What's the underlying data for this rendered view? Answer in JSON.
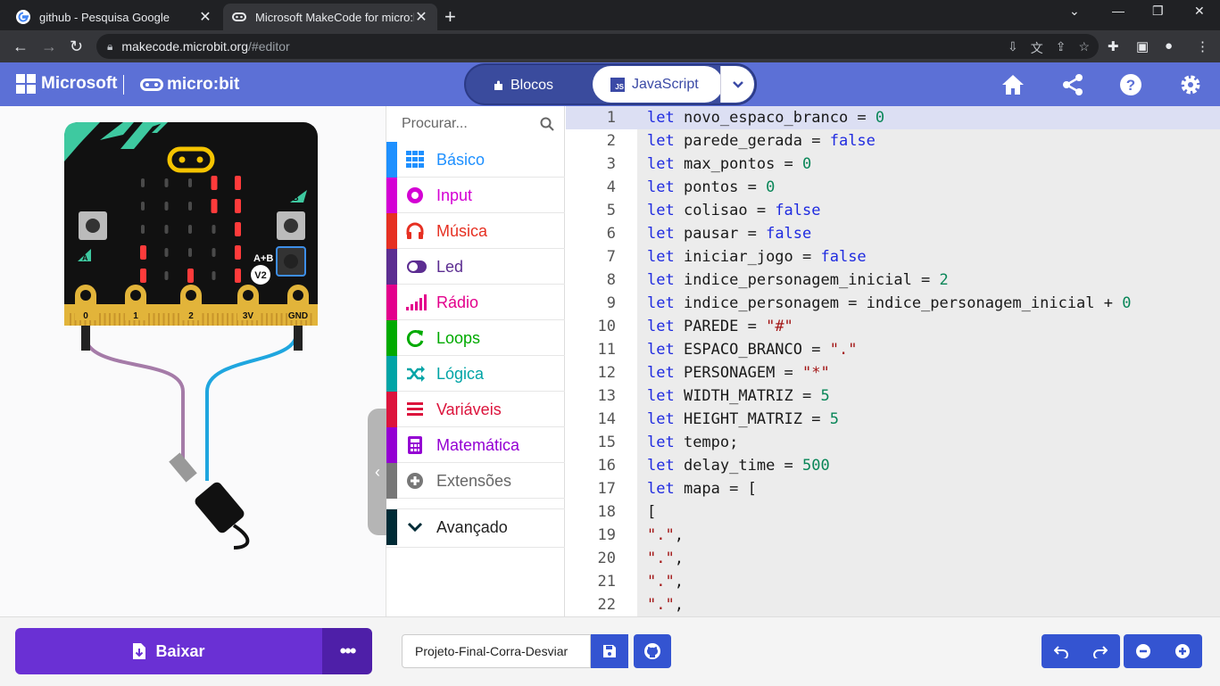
{
  "browser": {
    "tabs": [
      {
        "title": "github - Pesquisa Google",
        "icon": "google-icon"
      },
      {
        "title": "Microsoft MakeCode for micro:bi",
        "icon": "makecode-icon"
      }
    ],
    "url_host": "makecode.microbit.org",
    "url_path": "/#editor"
  },
  "header": {
    "brand": "Microsoft",
    "product": "micro:bit",
    "mode_blocks": "Blocos",
    "mode_js": "JavaScript",
    "js_badge": "JS"
  },
  "simulator": {
    "pins": [
      "0",
      "1",
      "2",
      "3V",
      "GND"
    ],
    "button_a": "A",
    "button_b": "B",
    "button_ab": "A+B",
    "version": "V2",
    "led_on": [
      [
        0,
        0,
        0,
        1,
        1
      ],
      [
        0,
        0,
        0,
        1,
        1
      ],
      [
        0,
        0,
        0,
        0,
        1
      ],
      [
        1,
        0,
        0,
        0,
        1
      ],
      [
        1,
        0,
        1,
        0,
        1
      ]
    ]
  },
  "toolbox": {
    "search_placeholder": "Procurar...",
    "categories": [
      {
        "label": "Básico",
        "color": "#1e90ff",
        "icon": "grid-icon"
      },
      {
        "label": "Input",
        "color": "#d400d4",
        "icon": "target-icon"
      },
      {
        "label": "Música",
        "color": "#e63022",
        "icon": "headphones-icon"
      },
      {
        "label": "Led",
        "color": "#5c2d91",
        "icon": "toggle-icon"
      },
      {
        "label": "Rádio",
        "color": "#e3008c",
        "icon": "signal-icon"
      },
      {
        "label": "Loops",
        "color": "#00aa00",
        "icon": "refresh-icon"
      },
      {
        "label": "Lógica",
        "color": "#00a4a6",
        "icon": "shuffle-icon"
      },
      {
        "label": "Variáveis",
        "color": "#dc143c",
        "icon": "list-icon"
      },
      {
        "label": "Matemática",
        "color": "#9400d3",
        "icon": "calculator-icon"
      },
      {
        "label": "Extensões",
        "color": "#777777",
        "icon": "plus-circle-icon"
      },
      {
        "label": "Avançado",
        "color": "#002b36",
        "icon": "chevron-down-icon"
      }
    ]
  },
  "code_lines": [
    [
      [
        "kw",
        "let"
      ],
      [
        "t",
        " novo_espaco_branco = "
      ],
      [
        "num",
        "0"
      ]
    ],
    [
      [
        "kw",
        "let"
      ],
      [
        "t",
        " parede_gerada = "
      ],
      [
        "kw",
        "false"
      ]
    ],
    [
      [
        "kw",
        "let"
      ],
      [
        "t",
        " max_pontos = "
      ],
      [
        "num",
        "0"
      ]
    ],
    [
      [
        "kw",
        "let"
      ],
      [
        "t",
        " pontos = "
      ],
      [
        "num",
        "0"
      ]
    ],
    [
      [
        "kw",
        "let"
      ],
      [
        "t",
        " colisao = "
      ],
      [
        "kw",
        "false"
      ]
    ],
    [
      [
        "kw",
        "let"
      ],
      [
        "t",
        " pausar = "
      ],
      [
        "kw",
        "false"
      ]
    ],
    [
      [
        "kw",
        "let"
      ],
      [
        "t",
        " iniciar_jogo = "
      ],
      [
        "kw",
        "false"
      ]
    ],
    [
      [
        "kw",
        "let"
      ],
      [
        "t",
        " indice_personagem_inicial = "
      ],
      [
        "num",
        "2"
      ]
    ],
    [
      [
        "kw",
        "let"
      ],
      [
        "t",
        " indice_personagem = indice_personagem_inicial + "
      ],
      [
        "num",
        "0"
      ]
    ],
    [
      [
        "kw",
        "let"
      ],
      [
        "t",
        " PAREDE = "
      ],
      [
        "str",
        "\"#\""
      ]
    ],
    [
      [
        "kw",
        "let"
      ],
      [
        "t",
        " ESPACO_BRANCO = "
      ],
      [
        "str",
        "\".\""
      ]
    ],
    [
      [
        "kw",
        "let"
      ],
      [
        "t",
        " PERSONAGEM = "
      ],
      [
        "str",
        "\"*\""
      ]
    ],
    [
      [
        "kw",
        "let"
      ],
      [
        "t",
        " WIDTH_MATRIZ = "
      ],
      [
        "num",
        "5"
      ]
    ],
    [
      [
        "kw",
        "let"
      ],
      [
        "t",
        " HEIGHT_MATRIZ = "
      ],
      [
        "num",
        "5"
      ]
    ],
    [
      [
        "kw",
        "let"
      ],
      [
        "t",
        " tempo;"
      ]
    ],
    [
      [
        "kw",
        "let"
      ],
      [
        "t",
        " delay_time = "
      ],
      [
        "num",
        "500"
      ]
    ],
    [
      [
        "kw",
        "let"
      ],
      [
        "t",
        " mapa = ["
      ]
    ],
    [
      [
        "t",
        "["
      ]
    ],
    [
      [
        "str",
        "\".\""
      ],
      [
        "t",
        ","
      ]
    ],
    [
      [
        "str",
        "\".\""
      ],
      [
        "t",
        ","
      ]
    ],
    [
      [
        "str",
        "\".\""
      ],
      [
        "t",
        ","
      ]
    ],
    [
      [
        "str",
        "\".\""
      ],
      [
        "t",
        ","
      ]
    ]
  ],
  "footer": {
    "download_label": "Baixar",
    "more_label": "•••",
    "project_name": "Projeto-Final-Corra-Desviar"
  }
}
